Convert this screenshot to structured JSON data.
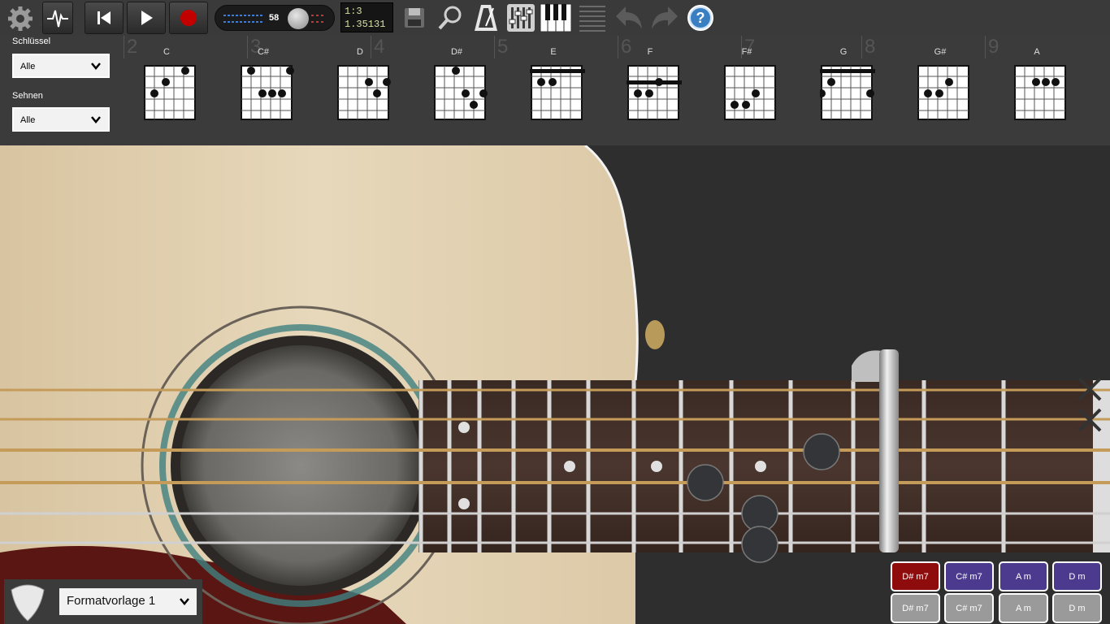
{
  "toolbar": {
    "tempo_value": "58",
    "lcd_line1": "1:3",
    "lcd_line2": "1.35131",
    "icons": [
      "gear-icon",
      "pulse-icon",
      "skip-back-icon",
      "play-icon",
      "record-icon",
      "save-icon",
      "search-icon",
      "metronome-icon",
      "mixer-icon",
      "piano-icon",
      "list-icon",
      "undo-icon",
      "redo-icon",
      "help-icon"
    ]
  },
  "chord_panel": {
    "key_label": "Schlüssel",
    "key_value": "Alle",
    "strings_label": "Sehnen",
    "strings_value": "Alle",
    "ruler_numbers": [
      "2",
      "3",
      "4",
      "5",
      "6",
      "7",
      "8",
      "9"
    ],
    "chords": [
      "C",
      "C#",
      "D",
      "D#",
      "E",
      "F",
      "F#",
      "G",
      "G#",
      "A"
    ]
  },
  "bottom": {
    "preset_label": "Formatvorlage 1",
    "chord_buttons_top": [
      "D# m7",
      "C# m7",
      "A m",
      "D m"
    ],
    "chord_buttons_bottom": [
      "D# m7",
      "C# m7",
      "A m",
      "D m"
    ]
  },
  "colors": {
    "active_chip": "#8e0c0c",
    "chip": "#4c3a8f",
    "inactive_chip": "#9a9a9a"
  }
}
